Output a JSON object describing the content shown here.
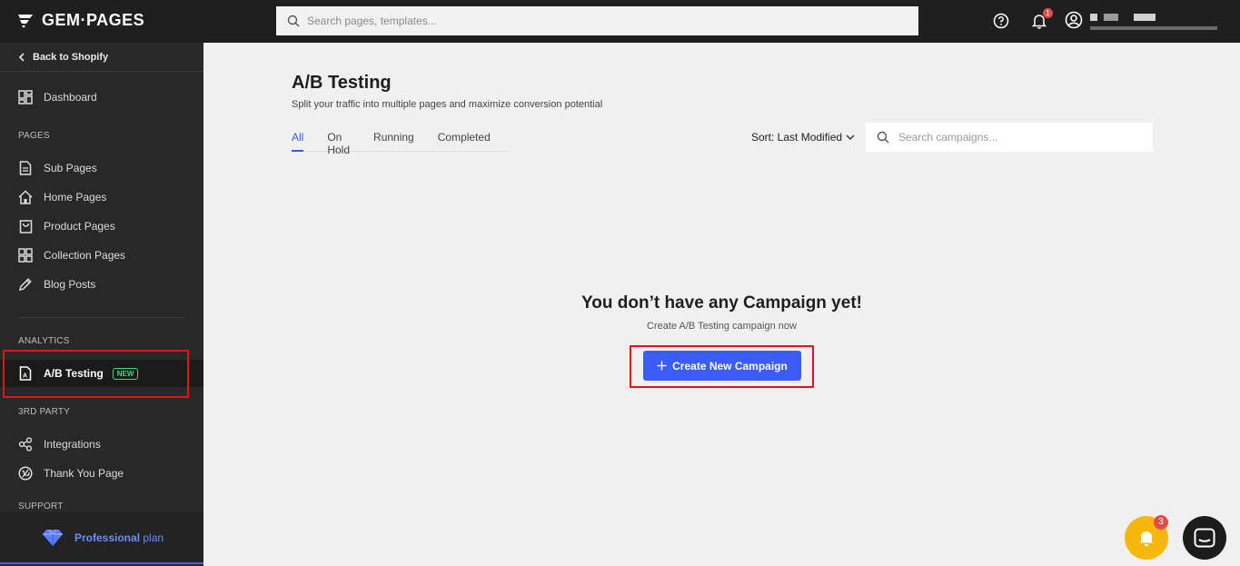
{
  "app": {
    "logo_text": "GEM·PAGES"
  },
  "topbar": {
    "search_placeholder": "Search pages, templates...",
    "notification_count": "1"
  },
  "sidebar": {
    "back_label": "Back to Shopify",
    "dashboard_label": "Dashboard",
    "pages_section": "PAGES",
    "pages_items": [
      {
        "label": "Sub Pages",
        "icon": "file-icon"
      },
      {
        "label": "Home Pages",
        "icon": "home-icon"
      },
      {
        "label": "Product Pages",
        "icon": "shopping-bag-icon"
      },
      {
        "label": "Collection Pages",
        "icon": "grid-icon"
      },
      {
        "label": "Blog Posts",
        "icon": "pencil-icon"
      }
    ],
    "analytics_section": "ANALYTICS",
    "ab_testing_label": "A/B Testing",
    "ab_testing_badge": "NEW",
    "third_party_section": "3RD PARTY",
    "third_party_items": [
      {
        "label": "Integrations",
        "icon": "share-nodes-icon"
      },
      {
        "label": "Thank You Page",
        "icon": "cart-check-icon"
      }
    ],
    "support_section": "SUPPORT",
    "plan_strong": "Professional",
    "plan_light": "plan"
  },
  "main": {
    "title": "A/B Testing",
    "subtitle": "Split your traffic into multiple pages and maximize conversion potential",
    "tabs": [
      {
        "label": "All",
        "active": true
      },
      {
        "label": "On Hold",
        "active": false
      },
      {
        "label": "Running",
        "active": false
      },
      {
        "label": "Completed",
        "active": false
      }
    ],
    "sort_label": "Sort: Last Modified",
    "search_placeholder": "Search campaigns...",
    "empty_title": "You don’t have any Campaign yet!",
    "empty_subtitle": "Create A/B Testing campaign now",
    "create_button": "Create New Campaign"
  },
  "fabs": {
    "bell_badge": "3"
  },
  "colors": {
    "accent": "#3b5cf5",
    "topbar_bg": "#1f1f1f",
    "sidebar_bg": "#282828",
    "highlight": "#e0141a",
    "new_badge": "#3bdc7a",
    "bell_fab": "#f6b80f"
  }
}
